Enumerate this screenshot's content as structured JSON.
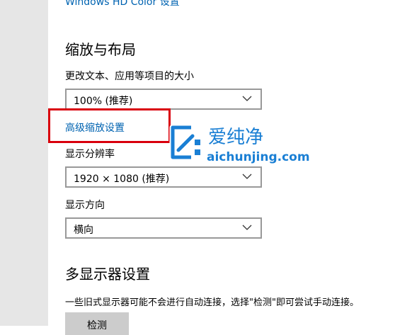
{
  "top_link": "Windows HD Color 设置",
  "scale_section": {
    "title": "缩放与布局",
    "size_label": "更改文本、应用等项目的大小",
    "size_value": "100% (推荐)",
    "advanced_link": "高级缩放设置",
    "resolution_label": "显示分辨率",
    "resolution_value": "1920 × 1080 (推荐)",
    "orientation_label": "显示方向",
    "orientation_value": "横向"
  },
  "multi_display": {
    "title": "多显示器设置",
    "description": "一些旧式显示器可能不会进行自动连接，选择\"检测\"即可尝试手动连接。",
    "detect_button": "检测"
  },
  "watermark": {
    "chinese": "爱纯净",
    "url": "aichunjing.com"
  },
  "colors": {
    "link": "#0063b1",
    "highlight_box": "#d9000c",
    "watermark_blue": "#1a7fd4"
  }
}
